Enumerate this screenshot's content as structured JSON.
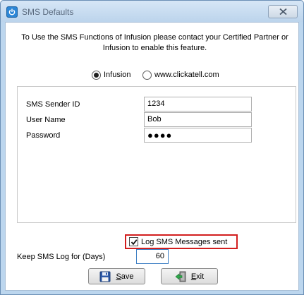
{
  "window": {
    "title": "SMS Defaults",
    "app_icon": "power-icon",
    "close_icon": "close-icon"
  },
  "notice": "To Use the SMS Functions of Infusion please contact your Certified Partner or Infusion to enable this feature.",
  "provider": {
    "options": [
      {
        "label": "Infusion",
        "selected": true
      },
      {
        "label": "www.clickatell.com",
        "selected": false
      }
    ]
  },
  "settings": {
    "sender_id": {
      "label": "SMS Sender ID",
      "value": "1234"
    },
    "user_name": {
      "label": "User Name",
      "value": "Bob"
    },
    "password": {
      "label": "Password",
      "value": "●●●●"
    }
  },
  "log": {
    "label": "Log SMS Messages sent",
    "checked": true,
    "highlight_color": "#d21e1e"
  },
  "keep_log": {
    "label": "Keep SMS Log for (Days)",
    "value": "60"
  },
  "buttons": {
    "save": {
      "label": "Save",
      "icon": "floppy-disk-icon"
    },
    "exit": {
      "label": "Exit",
      "icon": "exit-door-icon"
    }
  }
}
